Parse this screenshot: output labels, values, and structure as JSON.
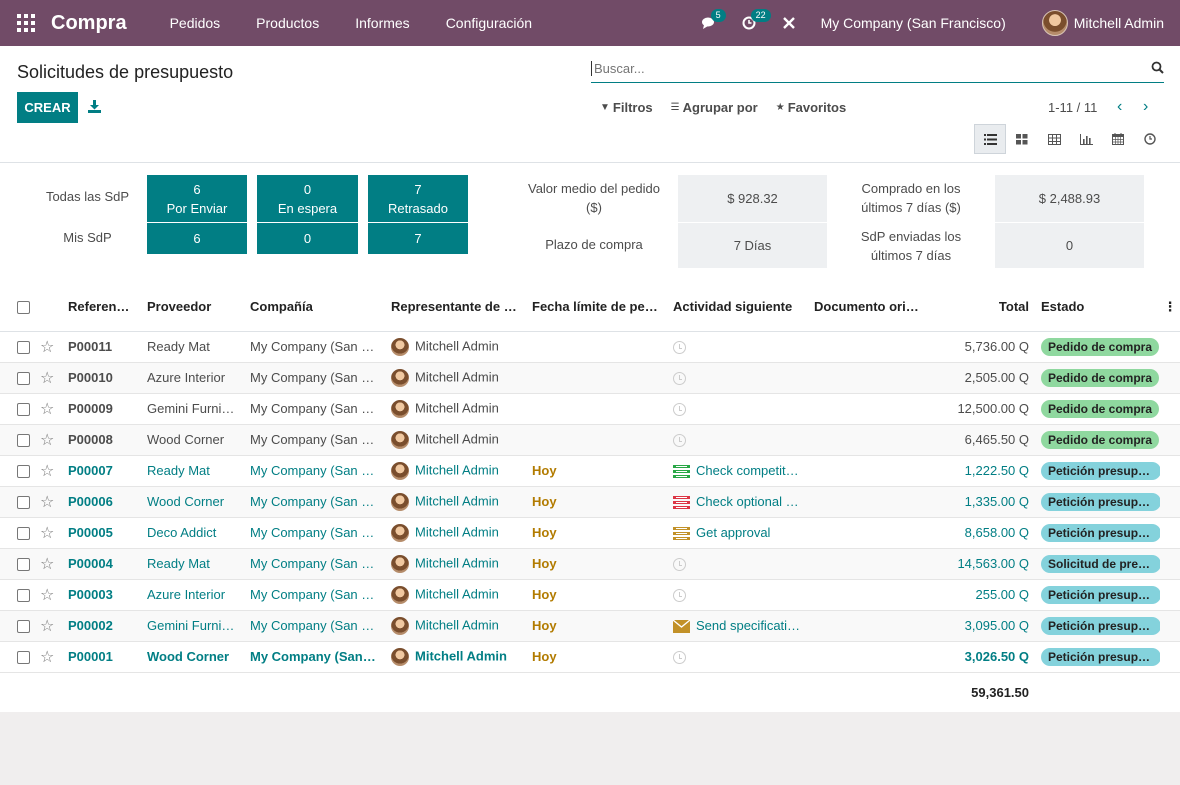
{
  "navbar": {
    "brand": "Compra",
    "menu": [
      "Pedidos",
      "Productos",
      "Informes",
      "Configuración"
    ],
    "messages_count": "5",
    "activities_count": "22",
    "company": "My Company (San Francisco)",
    "user": "Mitchell Admin"
  },
  "control": {
    "title": "Solicitudes de presupuesto",
    "create_label": "CREAR",
    "search_placeholder": "Buscar...",
    "filters_label": "Filtros",
    "group_label": "Agrupar por",
    "favorites_label": "Favoritos",
    "pager": "1-11 / 11"
  },
  "dashboard": {
    "all_label": "Todas las SdP",
    "my_label": "Mis SdP",
    "all": [
      {
        "value": "6",
        "label": "Por Enviar"
      },
      {
        "value": "0",
        "label": "En espera"
      },
      {
        "value": "7",
        "label": "Retrasado"
      }
    ],
    "mine": [
      "6",
      "0",
      "7"
    ],
    "avg_label": "Valor medio del pedido ($)",
    "avg_value": "$ 928.32",
    "lead_label": "Plazo de compra",
    "lead_value": "7  Días",
    "bought_label": "Comprado en los últimos 7 días ($)",
    "bought_value": "$ 2,488.93",
    "sent_label": "SdP enviadas los últimos 7 días",
    "sent_value": "0"
  },
  "table": {
    "headers": [
      "Referenc…",
      "Proveedor",
      "Compañía",
      "Representante de C…",
      "Fecha límite de ped…",
      "Actividad siguiente",
      "Documento orig…",
      "Total",
      "Estado"
    ],
    "rows": [
      {
        "ref": "P00011",
        "vendor": "Ready Mat",
        "company": "My Company (San Fr…",
        "rep": "Mitchell Admin",
        "date": "",
        "activity": "",
        "total": "5,736.00 Q",
        "status": "Pedido de compra"
      },
      {
        "ref": "P00010",
        "vendor": "Azure Interior",
        "company": "My Company (San Fr…",
        "rep": "Mitchell Admin",
        "date": "",
        "activity": "",
        "total": "2,505.00 Q",
        "status": "Pedido de compra"
      },
      {
        "ref": "P00009",
        "vendor": "Gemini Furnitu…",
        "company": "My Company (San Fr…",
        "rep": "Mitchell Admin",
        "date": "",
        "activity": "",
        "total": "12,500.00 Q",
        "status": "Pedido de compra"
      },
      {
        "ref": "P00008",
        "vendor": "Wood Corner",
        "company": "My Company (San Fr…",
        "rep": "Mitchell Admin",
        "date": "",
        "activity": "",
        "total": "6,465.50 Q",
        "status": "Pedido de compra"
      },
      {
        "ref": "P00007",
        "vendor": "Ready Mat",
        "company": "My Company (San Fr…",
        "rep": "Mitchell Admin",
        "date": "Hoy",
        "activity": "Check competito…",
        "total": "1,222.50 Q",
        "status": "Petición presupue…"
      },
      {
        "ref": "P00006",
        "vendor": "Wood Corner",
        "company": "My Company (San Fr…",
        "rep": "Mitchell Admin",
        "date": "Hoy",
        "activity": "Check optional p…",
        "total": "1,335.00 Q",
        "status": "Petición presupue…"
      },
      {
        "ref": "P00005",
        "vendor": "Deco Addict",
        "company": "My Company (San Fr…",
        "rep": "Mitchell Admin",
        "date": "Hoy",
        "activity": "Get approval",
        "total": "8,658.00 Q",
        "status": "Petición presupue…"
      },
      {
        "ref": "P00004",
        "vendor": "Ready Mat",
        "company": "My Company (San Fr…",
        "rep": "Mitchell Admin",
        "date": "Hoy",
        "activity": "",
        "total": "14,563.00 Q",
        "status": "Solicitud de presu…"
      },
      {
        "ref": "P00003",
        "vendor": "Azure Interior",
        "company": "My Company (San Fr…",
        "rep": "Mitchell Admin",
        "date": "Hoy",
        "activity": "",
        "total": "255.00 Q",
        "status": "Petición presupue…"
      },
      {
        "ref": "P00002",
        "vendor": "Gemini Furnitu…",
        "company": "My Company (San Fr…",
        "rep": "Mitchell Admin",
        "date": "Hoy",
        "activity": "Send specificati…",
        "total": "3,095.00 Q",
        "status": "Petición presupue…"
      },
      {
        "ref": "P00001",
        "vendor": "Wood Corner",
        "company": "My Company (San Fr…",
        "rep": "Mitchell Admin",
        "date": "Hoy",
        "activity": "",
        "total": "3,026.50 Q",
        "status": "Petición presupue…"
      }
    ],
    "grand_total": "59,361.50"
  },
  "colors": {
    "navbar": "#714b67",
    "primary": "#017e84",
    "status_green": "#8fd89f",
    "status_blue": "#84d2dc",
    "deadline": "#b27b00"
  }
}
